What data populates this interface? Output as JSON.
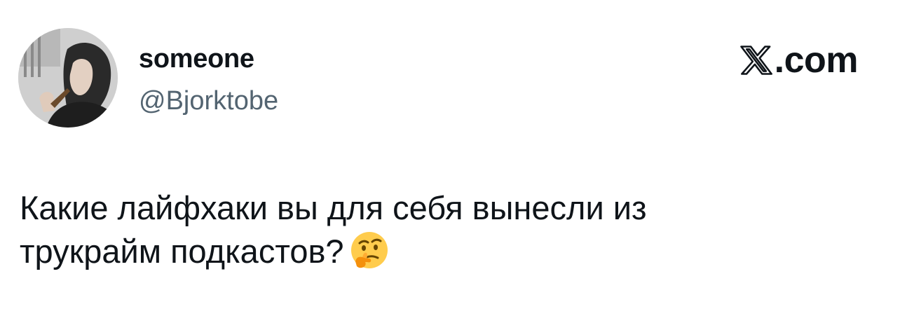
{
  "author": {
    "display_name": "someone",
    "handle": "@Bjorktobe"
  },
  "brand": {
    "label": ".com",
    "icon": "x-logo-icon"
  },
  "tweet": {
    "line1": "Какие лайфхаки вы для себя вынесли из",
    "line2": "трукрайм подкастов?",
    "emoji": "thinking-face-icon"
  },
  "colors": {
    "text": "#0f1419",
    "secondary": "#536471",
    "emoji_yellow": "#ffcc4d"
  }
}
